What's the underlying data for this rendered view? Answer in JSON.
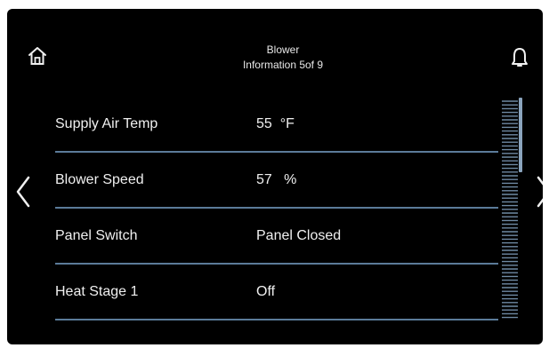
{
  "header": {
    "title": "Blower",
    "subtitle": "Information 5of 9"
  },
  "icons": {
    "home": "home-icon",
    "bell": "bell-icon",
    "prev": "chevron-left-icon",
    "next": "chevron-right-icon"
  },
  "rows": [
    {
      "label": "Supply Air Temp",
      "value": "55  °F"
    },
    {
      "label": "Blower Speed",
      "value": "57   %"
    },
    {
      "label": "Panel Switch",
      "value": "Panel Closed"
    },
    {
      "label": "Heat Stage 1",
      "value": "Off"
    }
  ],
  "scroll": {
    "position_fraction": 0.0,
    "visible_fraction": 0.33
  },
  "colors": {
    "background": "#000000",
    "text": "#f0f0f0",
    "divider": "#5b7b99",
    "scrollbar": "#8aa4bd"
  }
}
